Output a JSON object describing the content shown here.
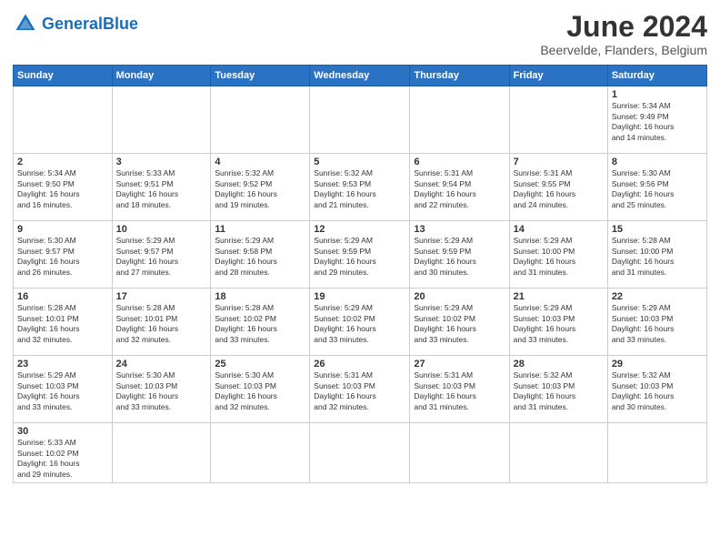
{
  "logo": {
    "text_general": "General",
    "text_blue": "Blue"
  },
  "header": {
    "month": "June 2024",
    "location": "Beervelde, Flanders, Belgium"
  },
  "weekdays": [
    "Sunday",
    "Monday",
    "Tuesday",
    "Wednesday",
    "Thursday",
    "Friday",
    "Saturday"
  ],
  "weeks": [
    [
      {
        "day": "",
        "info": ""
      },
      {
        "day": "",
        "info": ""
      },
      {
        "day": "",
        "info": ""
      },
      {
        "day": "",
        "info": ""
      },
      {
        "day": "",
        "info": ""
      },
      {
        "day": "",
        "info": ""
      },
      {
        "day": "1",
        "info": "Sunrise: 5:34 AM\nSunset: 9:49 PM\nDaylight: 16 hours\nand 14 minutes."
      }
    ],
    [
      {
        "day": "2",
        "info": "Sunrise: 5:34 AM\nSunset: 9:50 PM\nDaylight: 16 hours\nand 16 minutes."
      },
      {
        "day": "3",
        "info": "Sunrise: 5:33 AM\nSunset: 9:51 PM\nDaylight: 16 hours\nand 18 minutes."
      },
      {
        "day": "4",
        "info": "Sunrise: 5:32 AM\nSunset: 9:52 PM\nDaylight: 16 hours\nand 19 minutes."
      },
      {
        "day": "5",
        "info": "Sunrise: 5:32 AM\nSunset: 9:53 PM\nDaylight: 16 hours\nand 21 minutes."
      },
      {
        "day": "6",
        "info": "Sunrise: 5:31 AM\nSunset: 9:54 PM\nDaylight: 16 hours\nand 22 minutes."
      },
      {
        "day": "7",
        "info": "Sunrise: 5:31 AM\nSunset: 9:55 PM\nDaylight: 16 hours\nand 24 minutes."
      },
      {
        "day": "8",
        "info": "Sunrise: 5:30 AM\nSunset: 9:56 PM\nDaylight: 16 hours\nand 25 minutes."
      }
    ],
    [
      {
        "day": "9",
        "info": "Sunrise: 5:30 AM\nSunset: 9:57 PM\nDaylight: 16 hours\nand 26 minutes."
      },
      {
        "day": "10",
        "info": "Sunrise: 5:29 AM\nSunset: 9:57 PM\nDaylight: 16 hours\nand 27 minutes."
      },
      {
        "day": "11",
        "info": "Sunrise: 5:29 AM\nSunset: 9:58 PM\nDaylight: 16 hours\nand 28 minutes."
      },
      {
        "day": "12",
        "info": "Sunrise: 5:29 AM\nSunset: 9:59 PM\nDaylight: 16 hours\nand 29 minutes."
      },
      {
        "day": "13",
        "info": "Sunrise: 5:29 AM\nSunset: 9:59 PM\nDaylight: 16 hours\nand 30 minutes."
      },
      {
        "day": "14",
        "info": "Sunrise: 5:29 AM\nSunset: 10:00 PM\nDaylight: 16 hours\nand 31 minutes."
      },
      {
        "day": "15",
        "info": "Sunrise: 5:28 AM\nSunset: 10:00 PM\nDaylight: 16 hours\nand 31 minutes."
      }
    ],
    [
      {
        "day": "16",
        "info": "Sunrise: 5:28 AM\nSunset: 10:01 PM\nDaylight: 16 hours\nand 32 minutes."
      },
      {
        "day": "17",
        "info": "Sunrise: 5:28 AM\nSunset: 10:01 PM\nDaylight: 16 hours\nand 32 minutes."
      },
      {
        "day": "18",
        "info": "Sunrise: 5:28 AM\nSunset: 10:02 PM\nDaylight: 16 hours\nand 33 minutes."
      },
      {
        "day": "19",
        "info": "Sunrise: 5:29 AM\nSunset: 10:02 PM\nDaylight: 16 hours\nand 33 minutes."
      },
      {
        "day": "20",
        "info": "Sunrise: 5:29 AM\nSunset: 10:02 PM\nDaylight: 16 hours\nand 33 minutes."
      },
      {
        "day": "21",
        "info": "Sunrise: 5:29 AM\nSunset: 10:03 PM\nDaylight: 16 hours\nand 33 minutes."
      },
      {
        "day": "22",
        "info": "Sunrise: 5:29 AM\nSunset: 10:03 PM\nDaylight: 16 hours\nand 33 minutes."
      }
    ],
    [
      {
        "day": "23",
        "info": "Sunrise: 5:29 AM\nSunset: 10:03 PM\nDaylight: 16 hours\nand 33 minutes."
      },
      {
        "day": "24",
        "info": "Sunrise: 5:30 AM\nSunset: 10:03 PM\nDaylight: 16 hours\nand 33 minutes."
      },
      {
        "day": "25",
        "info": "Sunrise: 5:30 AM\nSunset: 10:03 PM\nDaylight: 16 hours\nand 32 minutes."
      },
      {
        "day": "26",
        "info": "Sunrise: 5:31 AM\nSunset: 10:03 PM\nDaylight: 16 hours\nand 32 minutes."
      },
      {
        "day": "27",
        "info": "Sunrise: 5:31 AM\nSunset: 10:03 PM\nDaylight: 16 hours\nand 31 minutes."
      },
      {
        "day": "28",
        "info": "Sunrise: 5:32 AM\nSunset: 10:03 PM\nDaylight: 16 hours\nand 31 minutes."
      },
      {
        "day": "29",
        "info": "Sunrise: 5:32 AM\nSunset: 10:03 PM\nDaylight: 16 hours\nand 30 minutes."
      }
    ],
    [
      {
        "day": "30",
        "info": "Sunrise: 5:33 AM\nSunset: 10:02 PM\nDaylight: 16 hours\nand 29 minutes."
      },
      {
        "day": "",
        "info": ""
      },
      {
        "day": "",
        "info": ""
      },
      {
        "day": "",
        "info": ""
      },
      {
        "day": "",
        "info": ""
      },
      {
        "day": "",
        "info": ""
      },
      {
        "day": "",
        "info": ""
      }
    ]
  ]
}
